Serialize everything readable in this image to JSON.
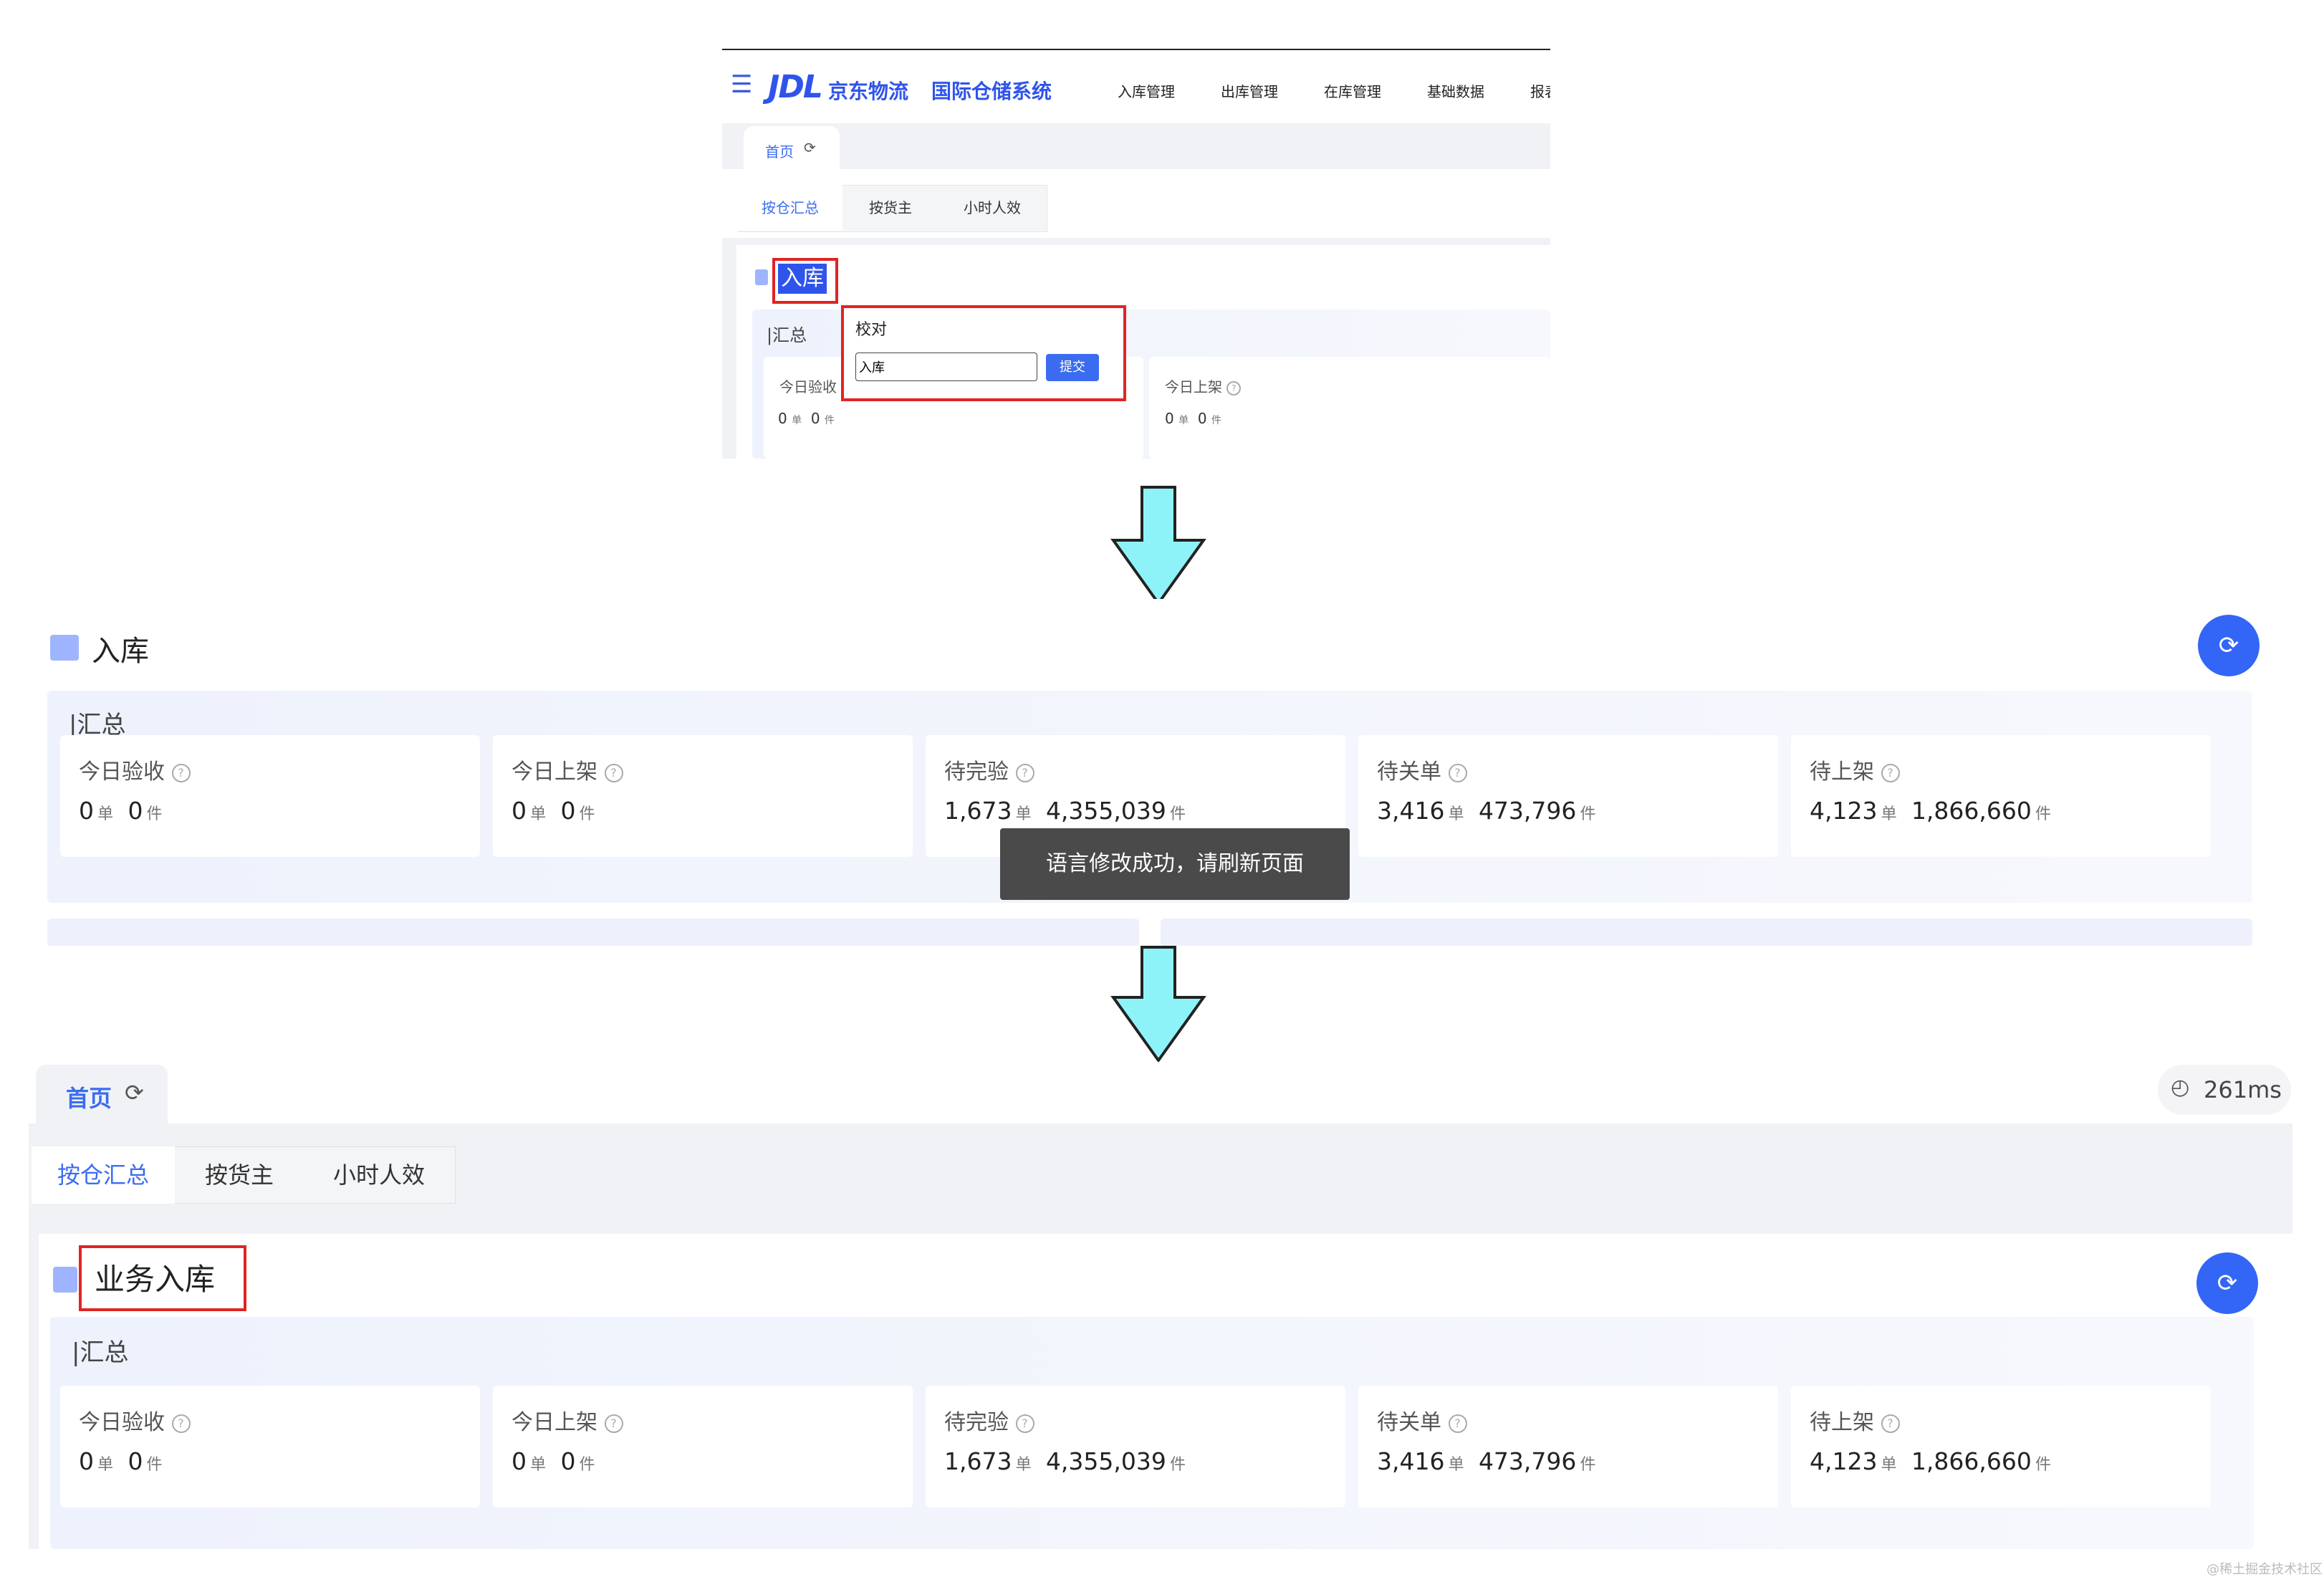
{
  "panel1": {
    "logo": {
      "mark": "JDL",
      "brand": "京东物流",
      "system": "国际仓储系统"
    },
    "nav": [
      "入库管理",
      "出库管理",
      "在库管理",
      "基础数据",
      "报表"
    ],
    "home_tab": "首页",
    "sub_tabs": [
      "按仓汇总",
      "按货主",
      "小时人效"
    ],
    "section_title": "入库",
    "summary_label": "汇总",
    "popover": {
      "title": "校对",
      "input_value": "入库",
      "submit": "提交"
    },
    "metrics": [
      {
        "label": "今日验收",
        "value1": "0",
        "unit1": "单",
        "value2": "0",
        "unit2": "件"
      },
      {
        "label": "今日上架",
        "value1": "0",
        "unit1": "单",
        "value2": "0",
        "unit2": "件"
      }
    ]
  },
  "panel2": {
    "section_title": "入库",
    "summary_label": "汇总",
    "toast": "语言修改成功，请刷新页面",
    "metrics": [
      {
        "label": "今日验收",
        "value1": "0",
        "unit1": "单",
        "value2": "0",
        "unit2": "件"
      },
      {
        "label": "今日上架",
        "value1": "0",
        "unit1": "单",
        "value2": "0",
        "unit2": "件"
      },
      {
        "label": "待完验",
        "value1": "1,673",
        "unit1": "单",
        "value2": "4,355,039",
        "unit2": "件"
      },
      {
        "label": "待关单",
        "value1": "3,416",
        "unit1": "单",
        "value2": "473,796",
        "unit2": "件"
      },
      {
        "label": "待上架",
        "value1": "4,123",
        "unit1": "单",
        "value2": "1,866,660",
        "unit2": "件"
      }
    ]
  },
  "panel3": {
    "home_tab": "首页",
    "timing": "261ms",
    "sub_tabs": [
      "按仓汇总",
      "按货主",
      "小时人效"
    ],
    "section_title": "业务入库",
    "summary_label": "汇总",
    "metrics": [
      {
        "label": "今日验收",
        "value1": "0",
        "unit1": "单",
        "value2": "0",
        "unit2": "件"
      },
      {
        "label": "今日上架",
        "value1": "0",
        "unit1": "单",
        "value2": "0",
        "unit2": "件"
      },
      {
        "label": "待完验",
        "value1": "1,673",
        "unit1": "单",
        "value2": "4,355,039",
        "unit2": "件"
      },
      {
        "label": "待关单",
        "value1": "3,416",
        "unit1": "单",
        "value2": "473,796",
        "unit2": "件"
      },
      {
        "label": "待上架",
        "value1": "4,123",
        "unit1": "单",
        "value2": "1,866,660",
        "unit2": "件"
      }
    ]
  },
  "colors": {
    "accent": "#3b6cf0",
    "highlight": "#e02424",
    "arrow": "#8ef3f8"
  },
  "watermark": "@稀土掘金技术社区"
}
